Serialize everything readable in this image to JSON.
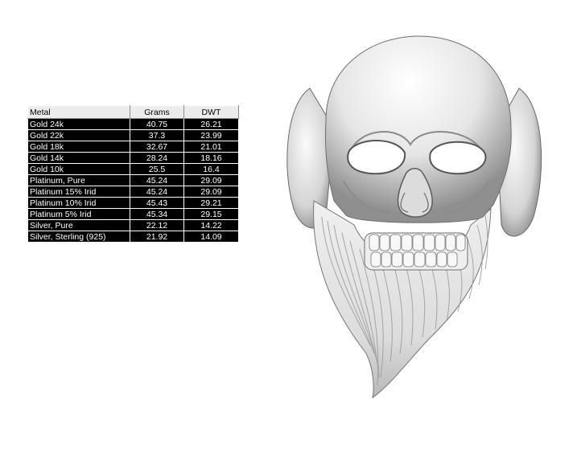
{
  "table": {
    "headers": [
      "Metal",
      "Grams",
      "DWT"
    ],
    "rows": [
      [
        "Gold 24k",
        "40.75",
        "26.21"
      ],
      [
        "Gold 22k",
        "37.3",
        "23.99"
      ],
      [
        "Gold 18k",
        "32.67",
        "21.01"
      ],
      [
        "Gold 14k",
        "28.24",
        "18.16"
      ],
      [
        "Gold 10k",
        "25.5",
        "16.4"
      ],
      [
        "Platinum, Pure",
        "45.24",
        "29.09"
      ],
      [
        "Platinum 15% Irid",
        "45.24",
        "29.09"
      ],
      [
        "Platinum 10% Irid",
        "45.43",
        "29.21"
      ],
      [
        "Platinum 5% Irid",
        "45.34",
        "29.15"
      ],
      [
        "Silver, Pure",
        "22.12",
        "14.22"
      ],
      [
        "Silver, Sterling (925)",
        "21.92",
        "14.09"
      ]
    ]
  },
  "model": {
    "icon": "bearded-skull-ring-render",
    "base_color": "#f2f2f2",
    "shadow_color": "#7a7a7a"
  }
}
